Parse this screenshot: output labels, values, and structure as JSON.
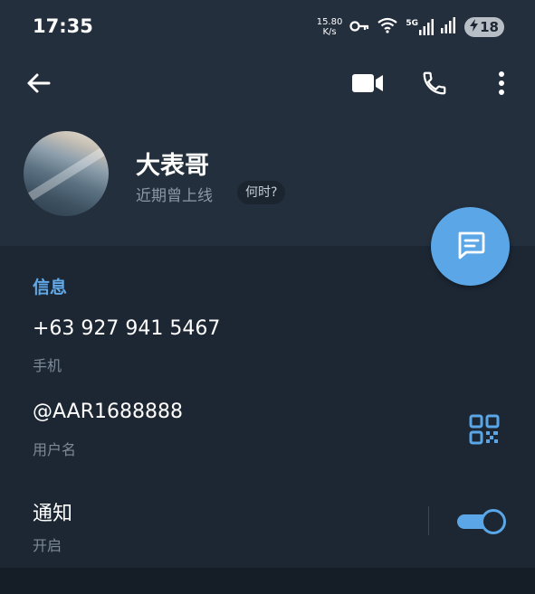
{
  "status_bar": {
    "time": "17:35",
    "net_speed_value": "15.80",
    "net_speed_unit": "K/s",
    "signal_label": "5G",
    "battery_level": "18"
  },
  "contact": {
    "name": "大表哥",
    "last_seen": "近期曾上线",
    "when_chip": "何时?"
  },
  "info": {
    "title": "信息",
    "phone_value": "+63 927 941 5467",
    "phone_label": "手机",
    "username_value": "@AAR1688888",
    "username_label": "用户名",
    "notifications_value": "通知",
    "notifications_label": "开启",
    "notifications_on": true
  },
  "icons": {
    "back": "arrow-left-icon",
    "video": "video-camera-icon",
    "call": "phone-icon",
    "more": "more-vertical-icon",
    "message": "message-icon",
    "qr": "qr-code-icon",
    "key": "vpn-key-icon",
    "wifi": "wifi-icon",
    "signal": "cell-signal-icon"
  },
  "colors": {
    "accent": "#5aa6e6",
    "header_bg": "#242f3d",
    "body_bg": "#1c2733",
    "secondary_text": "#7d8a98"
  }
}
